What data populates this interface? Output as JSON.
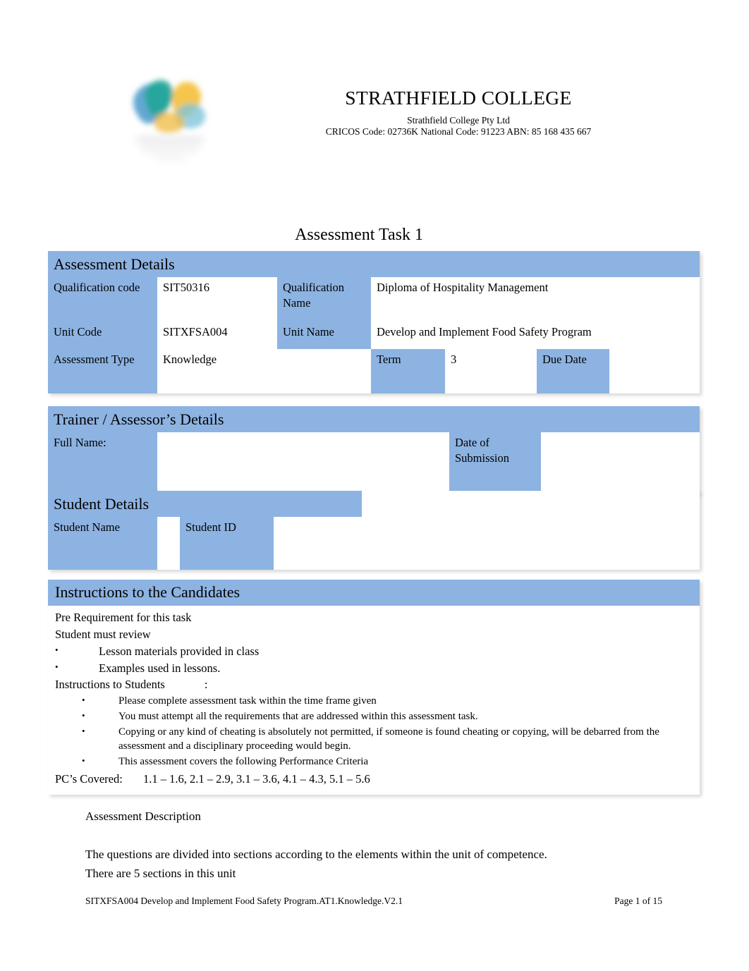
{
  "letterhead": {
    "logo_alt": "strathfield-college-logo",
    "college_name": "STRATHFIELD COLLEGE",
    "legal_name": "Strathfield College Pty Ltd",
    "codes": "CRICOS Code: 02736K National Code: 91223 ABN: 85 168 435 667"
  },
  "doc_title": "Assessment Task 1",
  "assessment_details": {
    "heading": "Assessment Details",
    "rows": [
      {
        "label1": "Qualification code",
        "value1": "SIT50316",
        "label2": "Qualification Name",
        "value2": "Diploma of Hospitality Management"
      },
      {
        "label1": "Unit Code",
        "value1": "SITXFSA004",
        "label2": "Unit Name",
        "value2": "Develop and Implement Food Safety Program"
      }
    ],
    "type_row": {
      "label_type": "Assessment Type",
      "value_type": "Knowledge",
      "label_term": "Term",
      "value_term": "3",
      "label_due": "Due Date",
      "value_due": ""
    }
  },
  "trainer_details": {
    "heading": "Trainer / Assessor’s Details",
    "label_full_name": "Full Name:",
    "value_full_name": "",
    "label_submission": "Date of Submission",
    "value_submission": ""
  },
  "student_details": {
    "heading": "Student Details",
    "label_student_name": "Student Name",
    "value_student_name": "",
    "label_student_id": "Student ID",
    "value_student_id": ""
  },
  "instructions": {
    "heading": "Instructions to the Candidates",
    "pre_requirement": "Pre Requirement for this task",
    "must_review": "Student must review",
    "review_items": [
      "Lesson materials provided in class",
      "Examples used in lessons."
    ],
    "to_students_label": "Instructions to Students",
    "to_students_colon": ":",
    "student_items": [
      "Please complete assessment task within the time frame given",
      "You must attempt all the requirements that are addressed within this assessment task.",
      "Copying or any kind of cheating is absolutely not permitted, if someone is found cheating or copying, will be debarred from the assessment and a disciplinary proceeding would begin.",
      "This assessment covers the following Performance Criteria"
    ],
    "pc_label": "PC’s Covered:",
    "pc_value": "1.1 – 1.6, 2.1 – 2.9, 3.1 – 3.6, 4.1 – 4.3, 5.1 – 5.6"
  },
  "description": {
    "heading": "Assessment Description",
    "line1": "The questions are divided into sections according to the elements within the unit of competence.",
    "line2": "There are 5 sections in this unit"
  },
  "footer": {
    "left": "SITXFSA004 Develop and Implement Food Safety Program.AT1.Knowledge.V2.1",
    "right": "Page 1 of 15"
  },
  "colors": {
    "table_blue": "#8DB3E2",
    "page_background": "#FFFFFF",
    "text": "#000000",
    "logo_teal": "#26A69A",
    "logo_yellow": "#F5C242",
    "logo_blue": "#5BA3D0"
  }
}
